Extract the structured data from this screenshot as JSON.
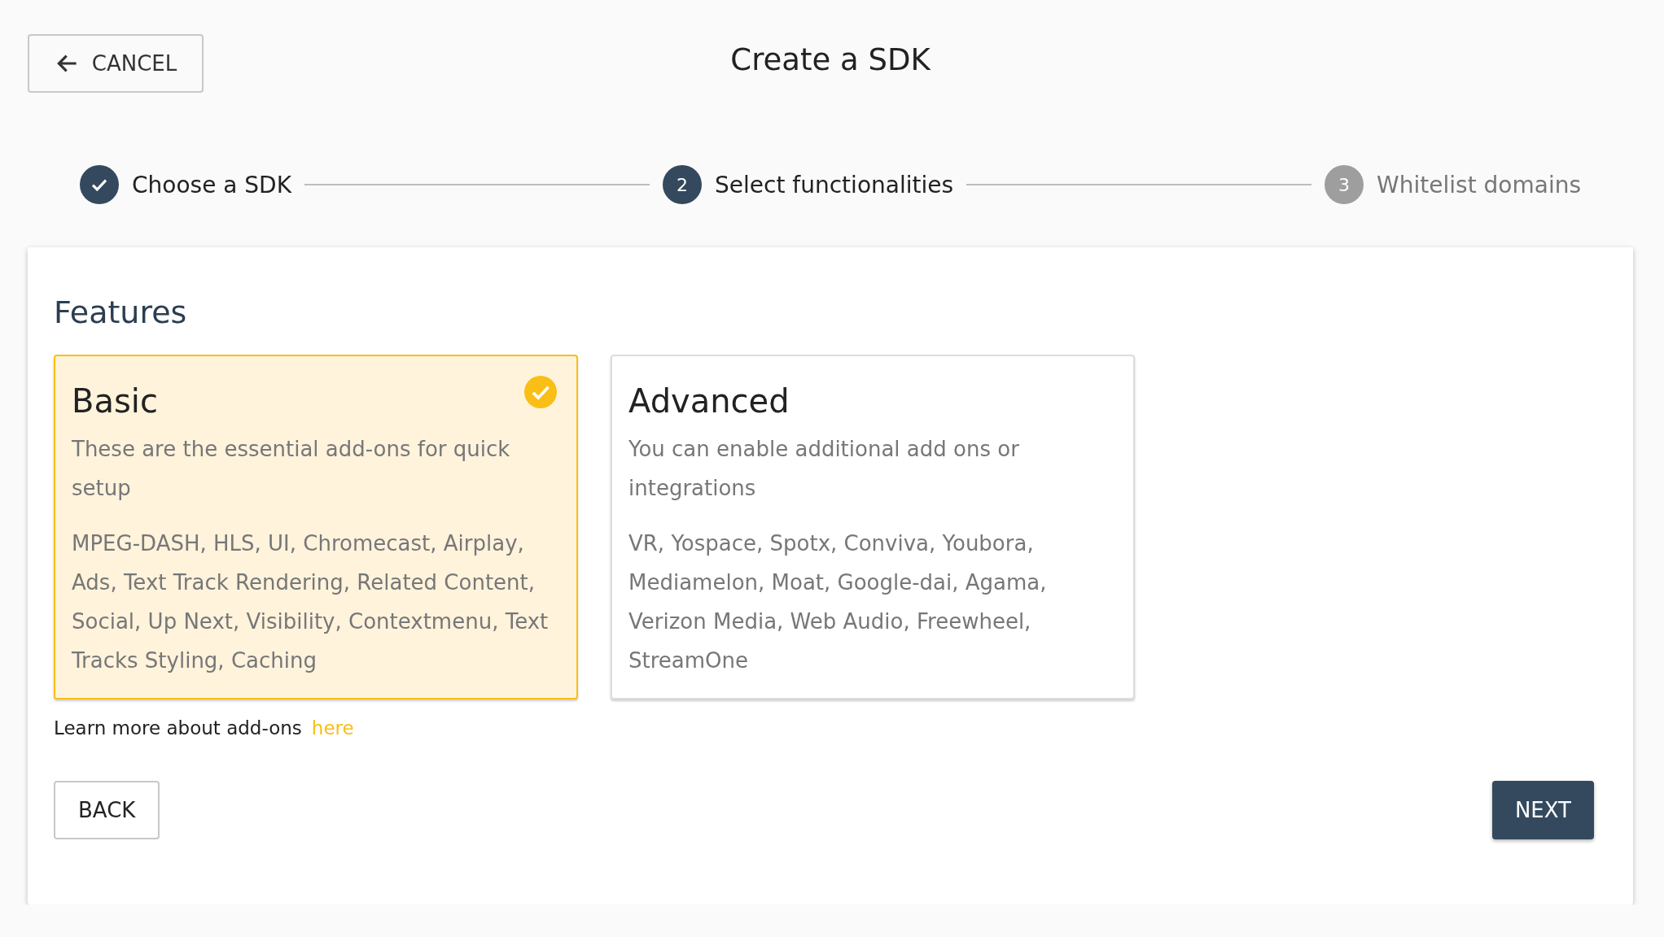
{
  "header": {
    "cancel_button": "CANCEL",
    "title": "Create a SDK"
  },
  "steps": [
    {
      "label": "Choose a SDK",
      "completed": true,
      "active": true
    },
    {
      "number": "2",
      "label": "Select functionalities",
      "completed": false,
      "active": true
    },
    {
      "number": "3",
      "label": "Whitelist domains",
      "completed": false,
      "active": false
    }
  ],
  "features": {
    "heading": "Features",
    "options": [
      {
        "title": "Basic",
        "description": "These are the essential add-ons for quick setup",
        "addons": "MPEG-DASH, HLS, UI, Chromecast, Airplay, Ads, Text Track Rendering, Related Content, Social, Up Next, Visibility, Contextmenu, Text Tracks Styling, Caching",
        "selected": true
      },
      {
        "title": "Advanced",
        "description": "You can enable additional add ons or integrations",
        "addons": "VR, Yospace, Spotx, Conviva, Youbora, Mediamelon, Moat, Google-dai, Agama, Verizon Media, Web Audio, Freewheel, StreamOne",
        "selected": false
      }
    ],
    "learn_more": {
      "text": "Learn more about add-ons",
      "link": "here"
    }
  },
  "buttons": {
    "back": "BACK",
    "next": "NEXT"
  }
}
